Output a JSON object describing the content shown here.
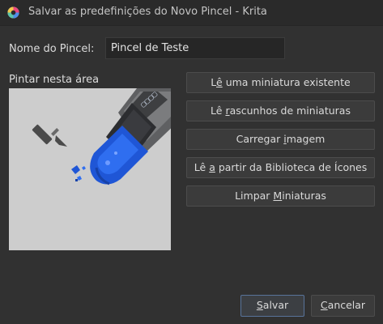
{
  "window": {
    "title": "Salvar as predefinições do Novo Pincel - Krita",
    "app_icon": "krita-icon"
  },
  "form": {
    "name_label": "Nome do Pincel:",
    "name_value": "Pincel de Teste",
    "paint_label": "Pintar nesta área"
  },
  "canvas": {
    "background": "#cdcdcd",
    "icons": [
      "paintbrush-icon",
      "eraser-icon"
    ],
    "accent": "#1f56d6"
  },
  "buttons": {
    "load_existing": {
      "pre": "L",
      "mn": "ê",
      "post": " uma miniatura existente"
    },
    "load_scratch": {
      "pre": "Lê ",
      "mn": "r",
      "post": "ascunhos de miniaturas"
    },
    "load_image": {
      "pre": "Carregar ",
      "mn": "i",
      "post": "magem"
    },
    "load_icon_library": {
      "pre": "Lê ",
      "mn": "a",
      "post": " partir da Biblioteca de Ícones"
    },
    "clear": {
      "pre": "Limpar ",
      "mn": "M",
      "post": "iniaturas"
    },
    "save": {
      "pre": "",
      "mn": "S",
      "post": "alvar"
    },
    "cancel": {
      "pre": "",
      "mn": "C",
      "post": "ancelar"
    }
  },
  "colors": {
    "window_bg": "#313131",
    "button_bg": "#3b3b3b",
    "focus_border": "#58739a"
  }
}
